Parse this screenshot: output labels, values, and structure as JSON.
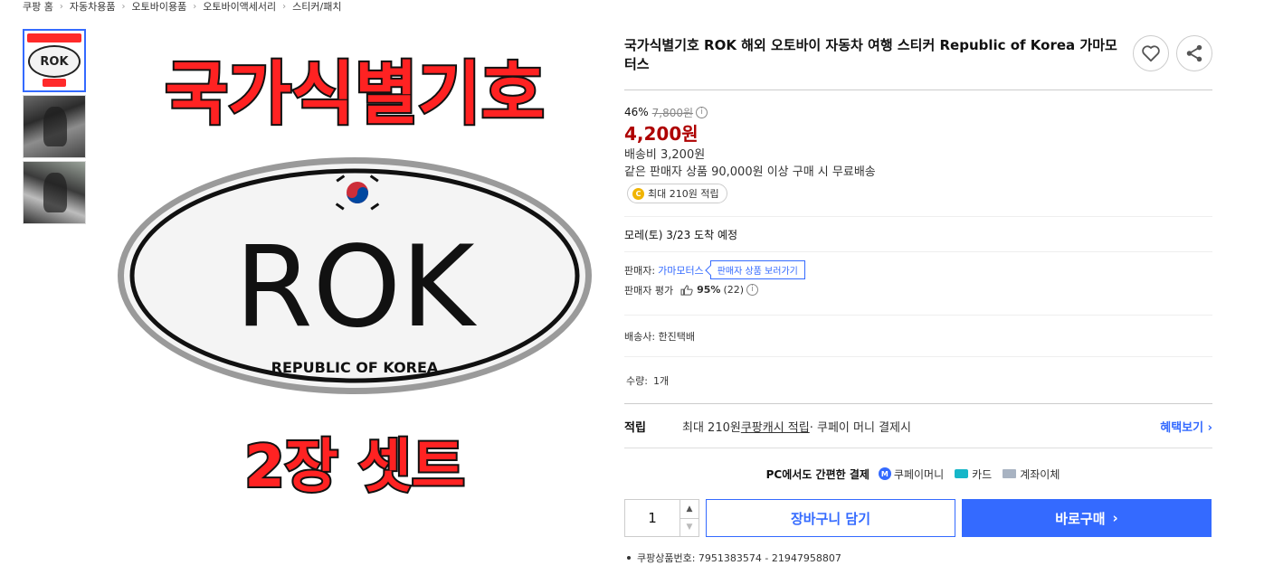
{
  "breadcrumb": [
    "쿠팡 홈",
    "자동차용품",
    "오토바이용품",
    "오토바이액세서리",
    "스티커/패치"
  ],
  "thumbnails": [
    "thumb-sticker",
    "thumb-photo-1",
    "thumb-photo-2"
  ],
  "main_image": {
    "top_text": "국가식별기호",
    "oval_text": "ROK",
    "oval_subtext": "REPUBLIC OF KOREA",
    "bottom_text": "2장 셋트",
    "thumb_top_text": "국가식별기호",
    "thumb_bottom_text": "2장 셋트"
  },
  "product": {
    "title": "국가식별기호 ROK 해외 오토바이 자동차 여행 스티커 Republic of Korea 가마모터스",
    "discount_rate": "46%",
    "original_price": "7,800원",
    "sale_price": "4,200원",
    "shipping_fee": "배송비 3,200원",
    "free_shipping_note": "같은 판매자 상품 90,000원 이상 구매 시 무료배송",
    "reward_badge": "최대 210원 적립",
    "coin_letter": "C"
  },
  "delivery": {
    "arrival": "모레(토) 3/23 도착 예정"
  },
  "seller": {
    "label": "판매자:",
    "name": "가마모터스",
    "tooltip": "판매자 상품 보러가기",
    "rating_label": "판매자 평가",
    "rating_value": "95%",
    "rating_count": "(22)"
  },
  "carrier": "배송사: 한진택배",
  "quantity": {
    "label": "수량:",
    "value": "1개"
  },
  "points": {
    "label": "적립",
    "text_pre": "최대 210원 ",
    "cash_link": "쿠팡캐시 적립",
    "text_post": " · 쿠페이 머니 결제시",
    "benefit_link": "혜택보기"
  },
  "payment": {
    "title": "PC에서도 간편한 결제",
    "options": [
      "쿠페이머니",
      "카드",
      "계좌이체"
    ]
  },
  "buy": {
    "qty_value": "1",
    "cart_label": "장바구니 담기",
    "buy_label": "바로구매"
  },
  "product_id": "쿠팡상품번호: 7951383574 - 21947958807",
  "colors": {
    "accent": "#346aff",
    "sale_price": "#ae0000",
    "sticker_red": "#ff2222"
  }
}
